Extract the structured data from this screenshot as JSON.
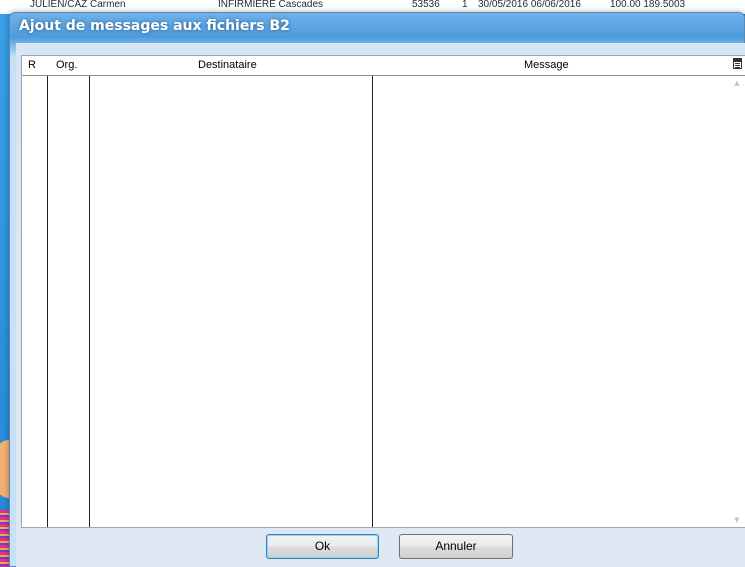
{
  "background_window": {
    "row_texts": [
      "JULIEN/CAZ Carmen",
      "INFIRMIERE Cascades",
      "53536",
      "1",
      "30/05/2016  06/06/2016",
      "100.00  189.5003"
    ]
  },
  "dialog": {
    "title": "Ajout de messages aux fichiers B2",
    "grid": {
      "columns": [
        "R",
        "Org.",
        "Destinataire",
        "Message"
      ],
      "rows": []
    },
    "buttons": {
      "ok_label": "Ok",
      "cancel_label": "Annuler"
    }
  },
  "icons": {
    "column-config": "column-chooser-icon",
    "scroll-up": "triangle-up",
    "scroll-down": "triangle-down"
  },
  "colors": {
    "desktop_blue": "#2b8fe0",
    "titlebar_blue": "#4d9bde",
    "client_area": "#dfe9f3",
    "ok_focus_border": "#3c7fb1"
  }
}
